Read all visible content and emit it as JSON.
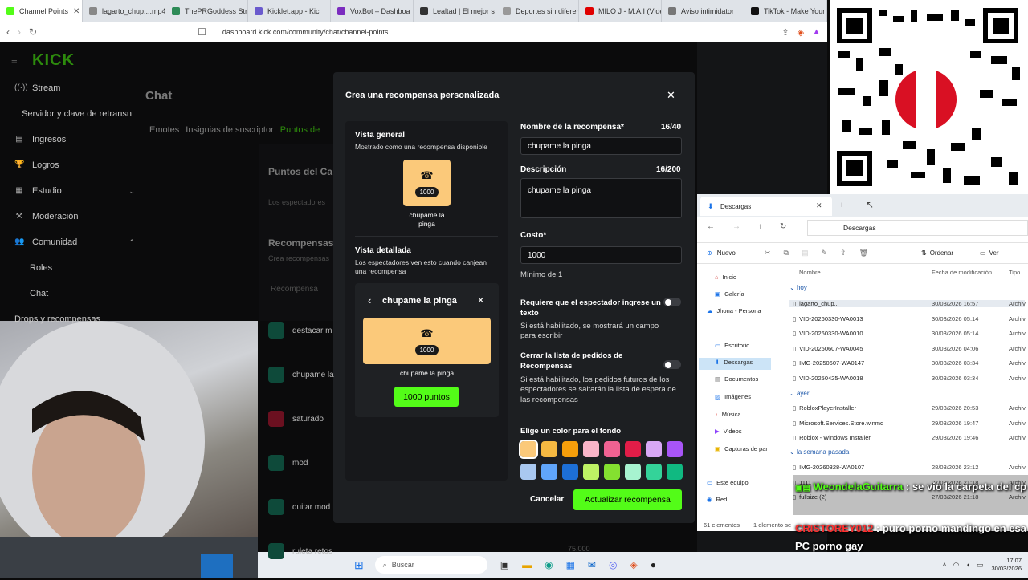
{
  "browser": {
    "tabs": [
      {
        "label": "Channel Points",
        "color": "#53fc18"
      },
      {
        "label": "lagarto_chup....mp4",
        "color": "#888888"
      },
      {
        "label": "ThePRGoddess Stre",
        "color": "#2e8b57"
      },
      {
        "label": "Kicklet.app - Kic",
        "color": "#6a5acd"
      },
      {
        "label": "VoxBot – Dashboa",
        "color": "#7b2cbf"
      },
      {
        "label": "Lealtad | El mejor s",
        "color": "#333333"
      },
      {
        "label": "Deportes sin diferen",
        "color": "#999999"
      },
      {
        "label": "MILO J - M.A.I (Vide",
        "color": "#e00000"
      },
      {
        "label": "Aviso intimidator",
        "color": "#777777"
      },
      {
        "label": "TikTok - Make Your",
        "color": "#111111"
      }
    ],
    "url": "dashboard.kick.com/community/chat/channel-points"
  },
  "kick": {
    "logo": "KICK",
    "sidebar": [
      {
        "label": "Stream",
        "icon": "broadcast-icon"
      },
      {
        "label": "Servidor y clave de retransn",
        "icon": ""
      },
      {
        "label": "Ingresos",
        "icon": "chart-icon"
      },
      {
        "label": "Logros",
        "icon": "trophy-icon"
      },
      {
        "label": "Estudio",
        "icon": "studio-icon"
      },
      {
        "label": "Moderación",
        "icon": "gavel-icon"
      },
      {
        "label": "Comunidad",
        "icon": "people-icon"
      },
      {
        "label": "Roles",
        "icon": ""
      },
      {
        "label": "Chat",
        "icon": ""
      },
      {
        "label": "Drops y recompensas",
        "icon": ""
      }
    ],
    "page_title": "Chat",
    "tabs": [
      "Emotes",
      "Insignias de suscriptor",
      "Puntos de"
    ],
    "section_title": "Puntos del Ca",
    "section_sub": "Los espectadores",
    "rewards_title": "Recompensas",
    "rewards_sub": "Crea recompensas",
    "column": "Recompensa",
    "rewards": [
      "destacar m",
      "chupame la",
      "saturado",
      "mod",
      "quitar mod",
      "ruleta retos"
    ],
    "last_cost": "75,000"
  },
  "modal": {
    "title": "Crea una recompensa personalizada",
    "overview_label": "Vista general",
    "overview_sub": "Mostrado como una recompensa disponible",
    "card_cost": "1000",
    "card_name": "chupame la pinga",
    "detail_label": "Vista detallada",
    "detail_sub": "Los espectadores ven esto cuando canjean una recompensa",
    "detail_title": "chupame la pinga",
    "detail_button": "1000 puntos",
    "name_label": "Nombre de la recompensa*",
    "name_count": "16/40",
    "name_value": "chupame la pinga",
    "desc_label": "Descripción",
    "desc_count": "16/200",
    "desc_value": "chupame la pinga",
    "cost_label": "Costo*",
    "cost_value": "1000",
    "cost_min": "Mínimo de 1",
    "req_label": "Requiere que el espectador ingrese un texto",
    "req_sub": "Si está habilitado, se mostrará un campo para escribir",
    "close_label": "Cerrar la lista de pedidos de Recompensas",
    "close_sub": "Si está habilitado, los pedidos futuros de los espectadores se saltarán la lista de espera de las recompensas",
    "color_label": "Elige un color para el fondo",
    "colors": [
      "#fbc97a",
      "#f5b942",
      "#f59e0b",
      "#f9b4c8",
      "#f06292",
      "#e11d48",
      "#d8a8f5",
      "#a855f7",
      "#a9c8f0",
      "#60a5fa",
      "#1d6fd6",
      "#bef264",
      "#84e030",
      "#a7f3d0",
      "#34d399",
      "#10b981"
    ],
    "cancel": "Cancelar",
    "submit": "Actualizar recompensa"
  },
  "explorer": {
    "tab_title": "Descargas",
    "breadcrumb": "Descargas",
    "toolbar_new": "Nuevo",
    "toolbar_sort": "Ordenar",
    "toolbar_view": "Ver",
    "col_name": "Nombre",
    "col_date": "Fecha de modificación",
    "col_type": "Tipo",
    "nav": [
      "Inicio",
      "Galería",
      "Jhona - Persona",
      "Escritorio",
      "Descargas",
      "Documentos",
      "Imágenes",
      "Música",
      "Videos",
      "Capturas de par",
      "Este equipo",
      "Red"
    ],
    "groups": [
      "hoy",
      "ayer",
      "la semana pasada"
    ],
    "files_today": [
      {
        "name": "lagarto_chup...",
        "date": "30/03/2026 16:57",
        "type": "Archiv"
      },
      {
        "name": "VID-20260330-WA0013",
        "date": "30/03/2026 05:14",
        "type": "Archiv"
      },
      {
        "name": "VID-20260330-WA0010",
        "date": "30/03/2026 05:14",
        "type": "Archiv"
      },
      {
        "name": "VID-20250607-WA0045",
        "date": "30/03/2026 04:06",
        "type": "Archiv"
      },
      {
        "name": "IMG-20250607-WA0147",
        "date": "30/03/2026 03:34",
        "type": "Archiv"
      },
      {
        "name": "VID-20250425-WA0018",
        "date": "30/03/2026 03:34",
        "type": "Archiv"
      }
    ],
    "files_yesterday": [
      {
        "name": "RobloxPlayerInstaller",
        "date": "29/03/2026 20:53",
        "type": "Archiv"
      },
      {
        "name": "Microsoft.Services.Store.winmd",
        "date": "29/03/2026 19:47",
        "type": "Archiv"
      },
      {
        "name": "Roblox - Windows Installer",
        "date": "29/03/2026 19:46",
        "type": "Archiv"
      }
    ],
    "files_week": [
      {
        "name": "IMG-20260328-WA0107",
        "date": "28/03/2026 23:12",
        "type": "Archiv"
      },
      {
        "name": "1111",
        "date": "27/03/2026 21:18",
        "type": "Archiv"
      },
      {
        "name": "fullsize (2)",
        "date": "27/03/2026 21:18",
        "type": "Archiv"
      }
    ],
    "status": "61 elementos",
    "status2": "1 elemento se"
  },
  "overlay_chat": [
    {
      "user": "WeondelaGuitarra",
      "sep": ":",
      "msg": "se vio la carpeta del cp",
      "user_color": "#53fc18"
    },
    {
      "user": "CRISTOREY012",
      "sep": ":",
      "msg": "puro porno mandingo en esa PC porno gay",
      "user_color": "#ff3030"
    }
  ],
  "taskbar": {
    "search": "Buscar",
    "time": "17:07",
    "date": "30/03/2026"
  }
}
